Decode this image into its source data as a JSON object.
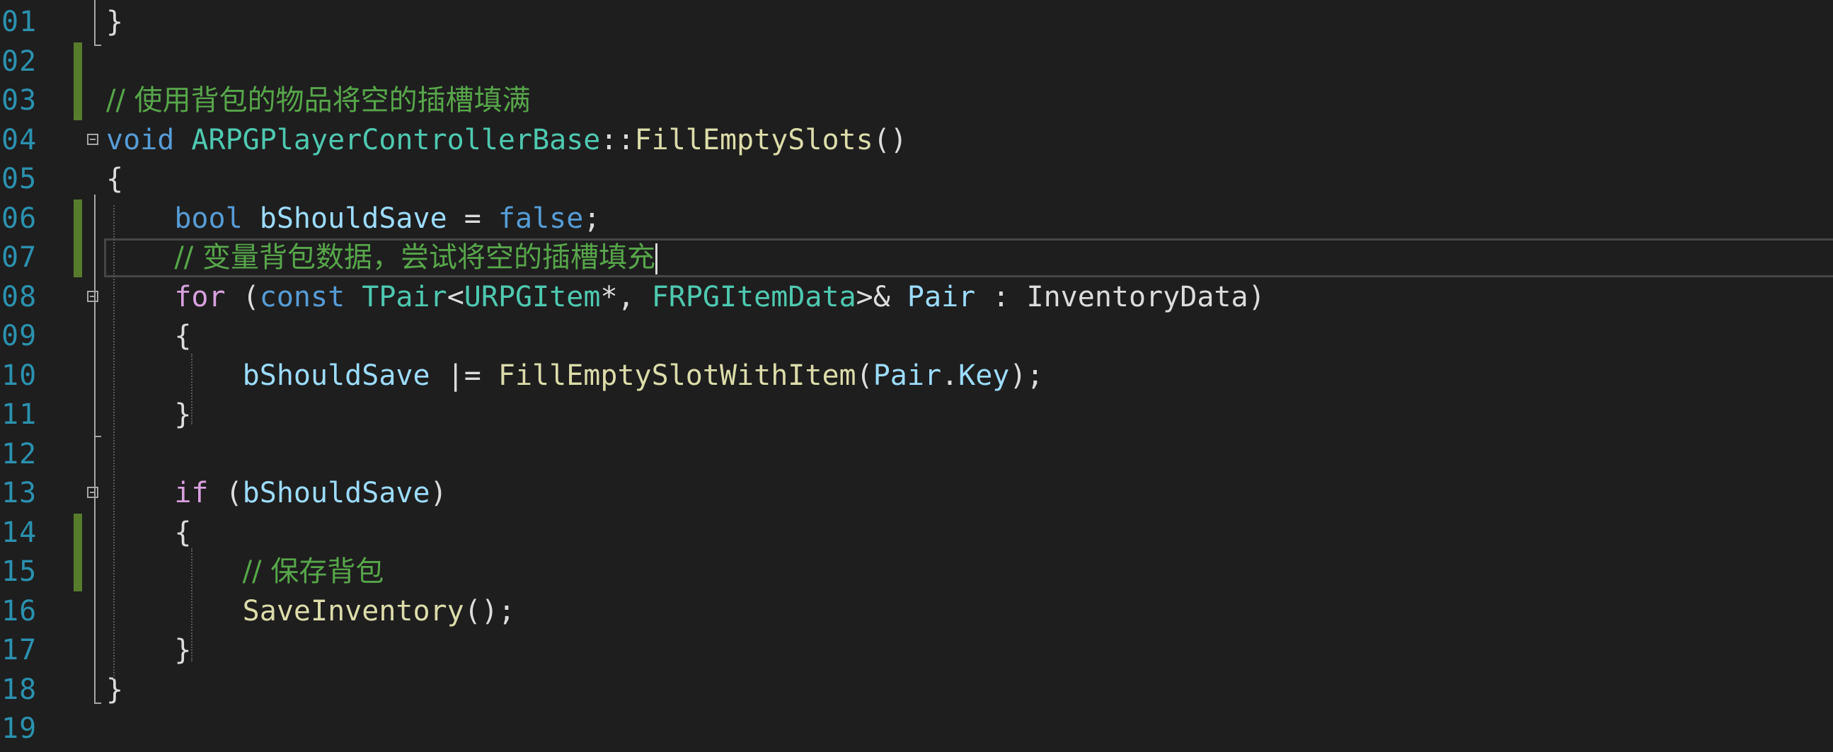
{
  "editor": {
    "lines": [
      {
        "num": "01",
        "tokens": [
          {
            "t": "}",
            "c": "plain"
          }
        ]
      },
      {
        "num": "02",
        "tokens": []
      },
      {
        "num": "03",
        "tokens": [
          {
            "t": "// 使用背包的物品将空的插槽填满",
            "c": "comment"
          }
        ]
      },
      {
        "num": "04",
        "tokens": [
          {
            "t": "void",
            "c": "kw"
          },
          {
            "t": " ",
            "c": "plain"
          },
          {
            "t": "ARPGPlayerControllerBase",
            "c": "type"
          },
          {
            "t": "::",
            "c": "plain"
          },
          {
            "t": "FillEmptySlots",
            "c": "fn"
          },
          {
            "t": "()",
            "c": "plain"
          }
        ]
      },
      {
        "num": "05",
        "tokens": [
          {
            "t": "{",
            "c": "plain"
          }
        ]
      },
      {
        "num": "06",
        "tokens": [
          {
            "t": "    ",
            "c": "plain"
          },
          {
            "t": "bool",
            "c": "kw"
          },
          {
            "t": " ",
            "c": "plain"
          },
          {
            "t": "bShouldSave",
            "c": "var"
          },
          {
            "t": " = ",
            "c": "plain"
          },
          {
            "t": "false",
            "c": "kw"
          },
          {
            "t": ";",
            "c": "plain"
          }
        ]
      },
      {
        "num": "07",
        "tokens": [
          {
            "t": "    ",
            "c": "plain"
          },
          {
            "t": "// 变量背包数据，尝试将空的插槽填充",
            "c": "comment"
          }
        ],
        "cursor": true
      },
      {
        "num": "08",
        "tokens": [
          {
            "t": "    ",
            "c": "plain"
          },
          {
            "t": "for",
            "c": "ctl"
          },
          {
            "t": " (",
            "c": "plain"
          },
          {
            "t": "const",
            "c": "kw"
          },
          {
            "t": " ",
            "c": "plain"
          },
          {
            "t": "TPair",
            "c": "type"
          },
          {
            "t": "<",
            "c": "plain"
          },
          {
            "t": "URPGItem",
            "c": "type"
          },
          {
            "t": "*, ",
            "c": "plain"
          },
          {
            "t": "FRPGItemData",
            "c": "type"
          },
          {
            "t": ">& ",
            "c": "plain"
          },
          {
            "t": "Pair",
            "c": "var"
          },
          {
            "t": " : ",
            "c": "plain"
          },
          {
            "t": "InventoryData",
            "c": "plain"
          },
          {
            "t": ")",
            "c": "plain"
          }
        ]
      },
      {
        "num": "09",
        "tokens": [
          {
            "t": "    {",
            "c": "plain"
          }
        ]
      },
      {
        "num": "10",
        "tokens": [
          {
            "t": "        ",
            "c": "plain"
          },
          {
            "t": "bShouldSave",
            "c": "var"
          },
          {
            "t": " |= ",
            "c": "plain"
          },
          {
            "t": "FillEmptySlotWithItem",
            "c": "fn"
          },
          {
            "t": "(",
            "c": "plain"
          },
          {
            "t": "Pair",
            "c": "var"
          },
          {
            "t": ".",
            "c": "plain"
          },
          {
            "t": "Key",
            "c": "var"
          },
          {
            "t": ");",
            "c": "plain"
          }
        ]
      },
      {
        "num": "11",
        "tokens": [
          {
            "t": "    }",
            "c": "plain"
          }
        ]
      },
      {
        "num": "12",
        "tokens": []
      },
      {
        "num": "13",
        "tokens": [
          {
            "t": "    ",
            "c": "plain"
          },
          {
            "t": "if",
            "c": "ctl"
          },
          {
            "t": " (",
            "c": "plain"
          },
          {
            "t": "bShouldSave",
            "c": "var"
          },
          {
            "t": ")",
            "c": "plain"
          }
        ]
      },
      {
        "num": "14",
        "tokens": [
          {
            "t": "    {",
            "c": "plain"
          }
        ]
      },
      {
        "num": "15",
        "tokens": [
          {
            "t": "        ",
            "c": "plain"
          },
          {
            "t": "// 保存背包",
            "c": "comment"
          }
        ]
      },
      {
        "num": "16",
        "tokens": [
          {
            "t": "        ",
            "c": "plain"
          },
          {
            "t": "SaveInventory",
            "c": "fn"
          },
          {
            "t": "();",
            "c": "plain"
          }
        ]
      },
      {
        "num": "17",
        "tokens": [
          {
            "t": "    }",
            "c": "plain"
          }
        ]
      },
      {
        "num": "18",
        "tokens": [
          {
            "t": "}",
            "c": "plain"
          }
        ]
      },
      {
        "num": "19",
        "tokens": []
      }
    ],
    "modified_lines": [
      "02",
      "03",
      "06",
      "07",
      "14",
      "15"
    ],
    "fold_lines": [
      "04",
      "08",
      "13"
    ],
    "colors": {
      "background": "#1e1e1e",
      "line_number": "#2b91af",
      "keyword": "#569cd6",
      "control": "#d8a0df",
      "type": "#4ec9b0",
      "function": "#dcdcaa",
      "variable": "#9cdcfe",
      "comment": "#57a64a",
      "modified_marker": "#577c2c"
    }
  }
}
